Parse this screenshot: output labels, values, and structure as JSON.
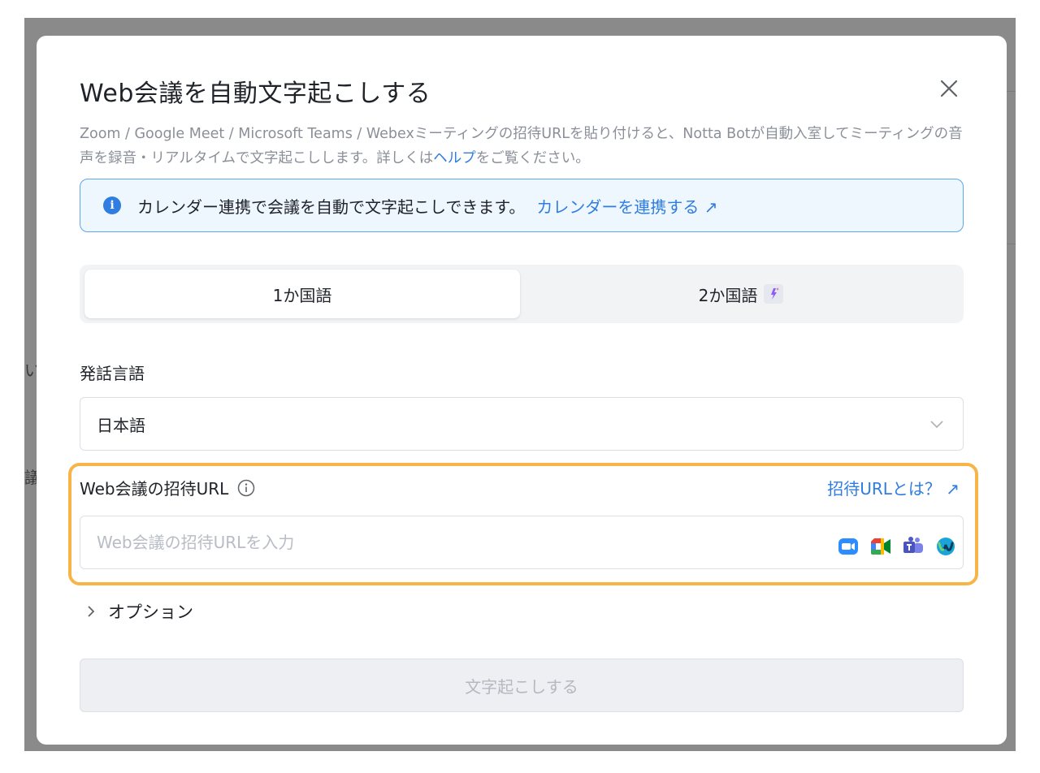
{
  "modal": {
    "title": "Web会議を自動文字起こしする",
    "description_before_link": "Zoom / Google Meet / Microsoft Teams / Webexミーティングの招待URLを貼り付けると、Notta Botが自動入室してミーティングの音声を録音・リアルタイムで文字起こしします。詳しくは",
    "description_link": "ヘルプ",
    "description_after_link": "をご覧ください。"
  },
  "banner": {
    "message": "カレンダー連携で会議を自動で文字起こしできます。",
    "cta": "カレンダーを連携する ↗"
  },
  "language_mode": {
    "tabs": [
      {
        "label": "1か国語",
        "active": true
      },
      {
        "label": "2か国語",
        "active": false
      }
    ]
  },
  "speech_language": {
    "label": "発話言語",
    "selected": "日本語"
  },
  "invite_url": {
    "label": "Web会議の招待URL",
    "help_link": "招待URLとは？ ↗",
    "placeholder": "Web会議の招待URLを入力",
    "value": "",
    "app_icons": [
      "zoom-icon",
      "google-meet-icon",
      "microsoft-teams-icon",
      "webex-icon"
    ]
  },
  "options": {
    "label": "オプション"
  },
  "submit": {
    "label": "文字起こしする",
    "disabled": true
  },
  "colors": {
    "accent": "#2f7de1",
    "highlight": "#f7b547",
    "banner_bg": "#eef6fe"
  }
}
